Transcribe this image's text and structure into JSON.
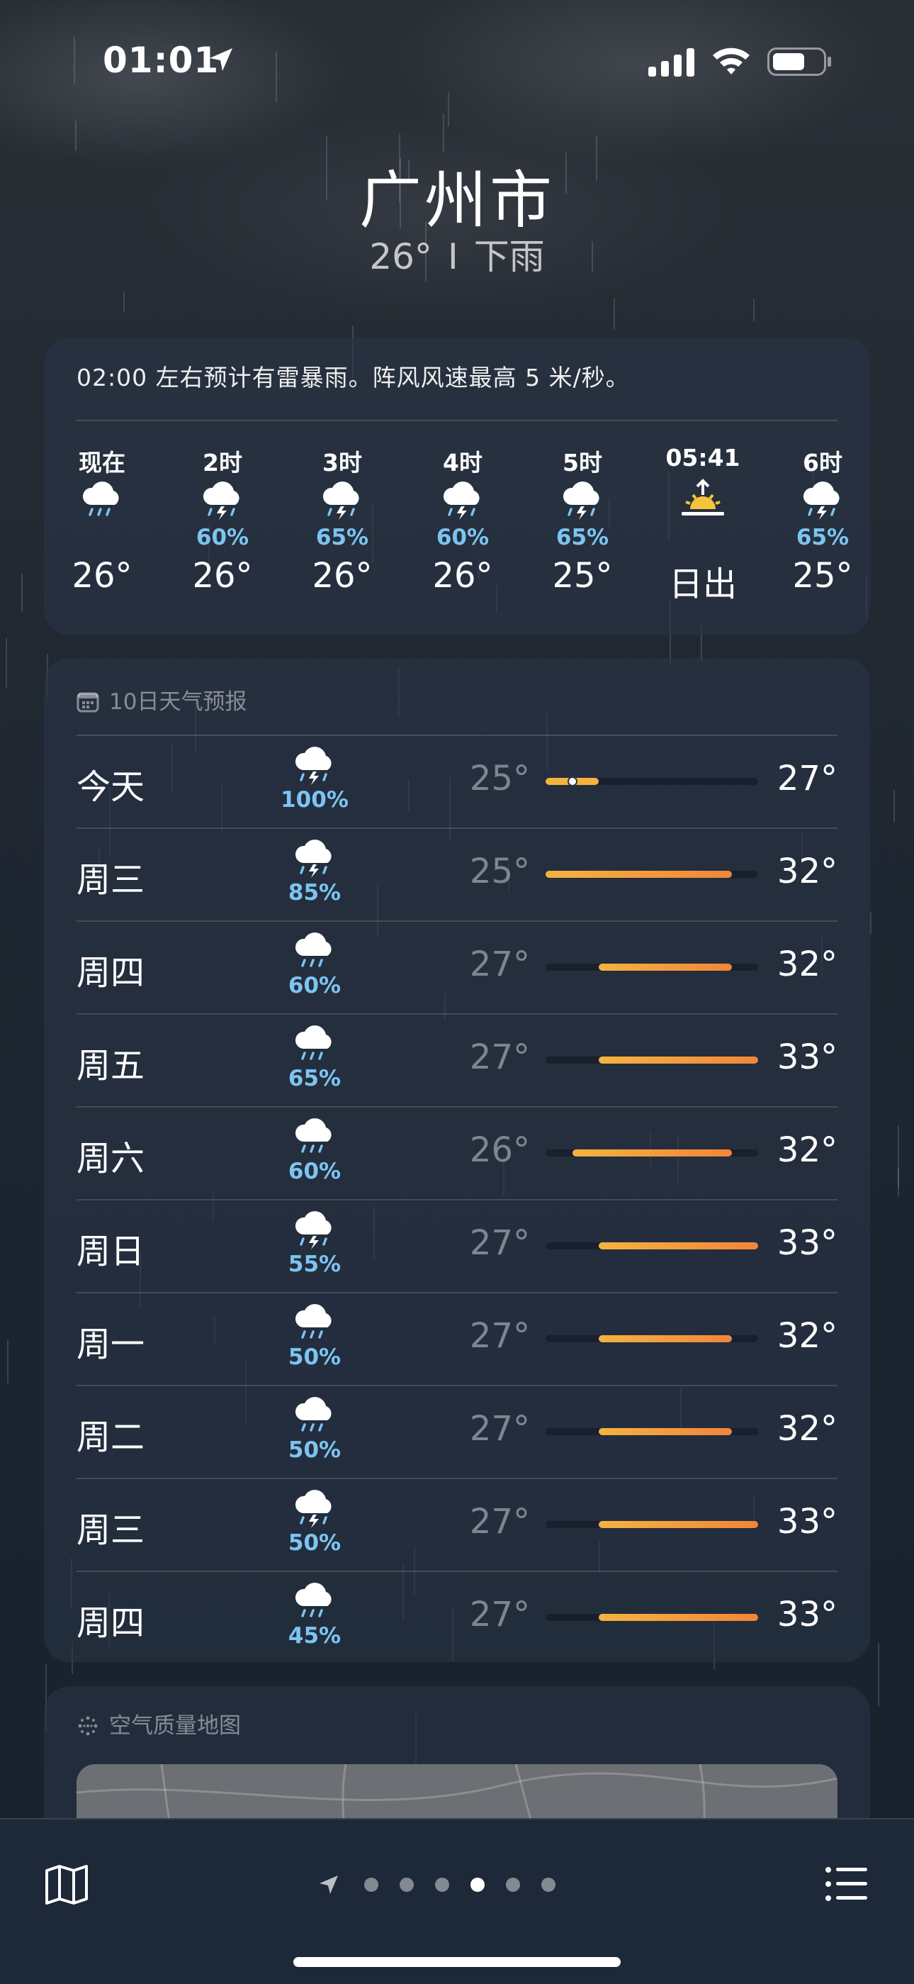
{
  "status_bar": {
    "time": "01:01",
    "icons": [
      "location-arrow-icon",
      "cellular-signal-icon",
      "wifi-icon",
      "battery-icon"
    ]
  },
  "header": {
    "city": "广州市",
    "temperature": "26°",
    "separator": "I",
    "condition": "下雨"
  },
  "hourly": {
    "alert": "02:00 左右预计有雷暴雨。阵风风速最高 5 米/秒。",
    "items": [
      {
        "label": "现在",
        "icon": "rain-cloud-icon",
        "precip": "",
        "temp": "26°"
      },
      {
        "label": "2时",
        "icon": "thunderstorm-icon",
        "precip": "60%",
        "temp": "26°"
      },
      {
        "label": "3时",
        "icon": "thunderstorm-icon",
        "precip": "65%",
        "temp": "26°"
      },
      {
        "label": "4时",
        "icon": "thunderstorm-icon",
        "precip": "60%",
        "temp": "26°"
      },
      {
        "label": "5时",
        "icon": "thunderstorm-icon",
        "precip": "65%",
        "temp": "25°"
      },
      {
        "label": "05:41",
        "icon": "sunrise-icon",
        "precip": "",
        "temp": "日出"
      },
      {
        "label": "6时",
        "icon": "thunderstorm-icon",
        "precip": "65%",
        "temp": "25°"
      }
    ]
  },
  "forecast": {
    "title": "10日天气预报",
    "range_min": 25,
    "range_max": 33,
    "days": [
      {
        "day": "今天",
        "icon": "thunderstorm-icon",
        "precip": "100%",
        "low": "25°",
        "high": "27°",
        "low_val": 25,
        "high_val": 27,
        "current": 26
      },
      {
        "day": "周三",
        "icon": "thunderstorm-icon",
        "precip": "85%",
        "low": "25°",
        "high": "32°",
        "low_val": 25,
        "high_val": 32
      },
      {
        "day": "周四",
        "icon": "rain-cloud-icon",
        "precip": "60%",
        "low": "27°",
        "high": "32°",
        "low_val": 27,
        "high_val": 32
      },
      {
        "day": "周五",
        "icon": "rain-cloud-icon",
        "precip": "65%",
        "low": "27°",
        "high": "33°",
        "low_val": 27,
        "high_val": 33
      },
      {
        "day": "周六",
        "icon": "rain-cloud-icon",
        "precip": "60%",
        "low": "26°",
        "high": "32°",
        "low_val": 26,
        "high_val": 32
      },
      {
        "day": "周日",
        "icon": "thunderstorm-icon",
        "precip": "55%",
        "low": "27°",
        "high": "33°",
        "low_val": 27,
        "high_val": 33
      },
      {
        "day": "周一",
        "icon": "rain-cloud-icon",
        "precip": "50%",
        "low": "27°",
        "high": "32°",
        "low_val": 27,
        "high_val": 32
      },
      {
        "day": "周二",
        "icon": "rain-cloud-icon",
        "precip": "50%",
        "low": "27°",
        "high": "32°",
        "low_val": 27,
        "high_val": 32
      },
      {
        "day": "周三",
        "icon": "thunderstorm-icon",
        "precip": "50%",
        "low": "27°",
        "high": "33°",
        "low_val": 27,
        "high_val": 33
      },
      {
        "day": "周四",
        "icon": "rain-cloud-icon",
        "precip": "45%",
        "low": "27°",
        "high": "33°",
        "low_val": 27,
        "high_val": 33
      }
    ]
  },
  "air_quality": {
    "title": "空气质量地图"
  },
  "bottom_bar": {
    "page_count": 7,
    "active_page": 4,
    "icons": [
      "map-icon",
      "location-arrow-icon",
      "list-icon"
    ]
  },
  "colors": {
    "precip": "#7cc4f2",
    "bar_cool": "#f4b33f",
    "bar_warm": "#f2853a"
  }
}
